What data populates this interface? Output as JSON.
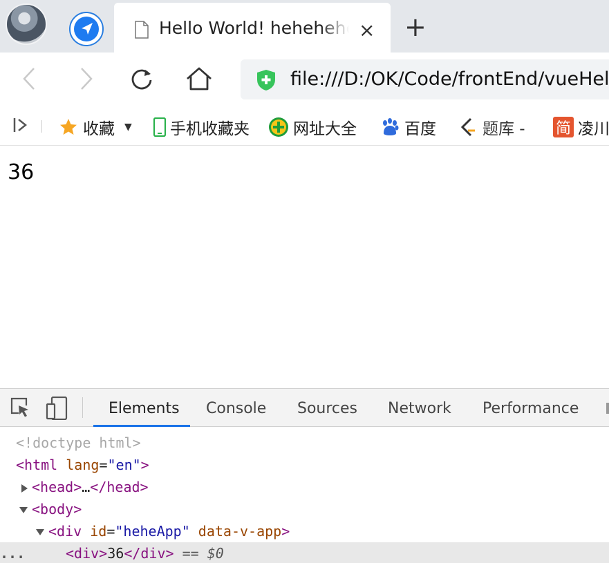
{
  "tab": {
    "title": "Hello World! hehehehehe",
    "close": "×",
    "new_tab": "+"
  },
  "toolbar": {
    "url": "file:///D:/OK/Code/frontEnd/vueHello"
  },
  "bookmarks": {
    "items": [
      {
        "label": "收藏",
        "icon": "star-icon"
      },
      {
        "label": "手机收藏夹",
        "icon": "phone-icon"
      },
      {
        "label": "网址大全",
        "icon": "globe-icon"
      },
      {
        "label": "百度",
        "icon": "baidu-paw-icon"
      },
      {
        "label": "题库 -",
        "icon": "tiku-icon"
      },
      {
        "label": "凌川",
        "icon": "jian-icon"
      }
    ],
    "jian_char": "简"
  },
  "page": {
    "content": "36"
  },
  "devtools": {
    "tabs": [
      "Elements",
      "Console",
      "Sources",
      "Network",
      "Performance"
    ],
    "active_tab": "Elements",
    "accent_color": "#1a73e8",
    "dom": {
      "doctype": "<!doctype html>",
      "html_lang_attr": "lang",
      "html_lang_val": "\"en\"",
      "head_ellipsis": "…",
      "div_id_attr": "id",
      "div_id_val": "\"heheApp\"",
      "div_data_attr": "data-v-app",
      "inner_text": "36",
      "selected_marker": "== $0",
      "gutter_dots": "..."
    }
  }
}
